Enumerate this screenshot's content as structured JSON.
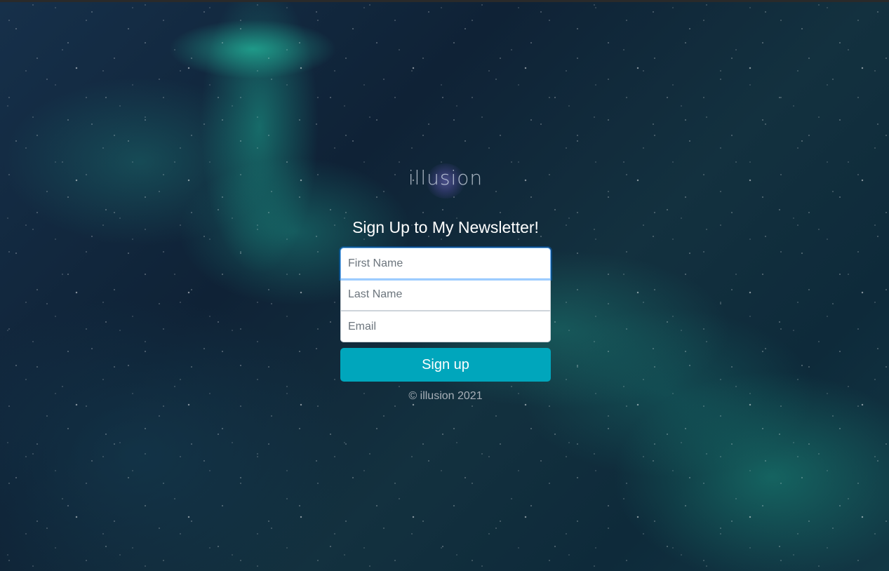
{
  "brand": {
    "logo_text": "illusion"
  },
  "form": {
    "title": "Sign Up to My Newsletter!",
    "first_name_placeholder": "First Name",
    "last_name_placeholder": "Last Name",
    "email_placeholder": "Email",
    "first_name_value": "",
    "last_name_value": "",
    "email_value": "",
    "submit_label": "Sign up"
  },
  "footer": {
    "text": "© illusion 2021"
  },
  "colors": {
    "button": "#00a6bc",
    "focus_border": "#80bdff"
  }
}
